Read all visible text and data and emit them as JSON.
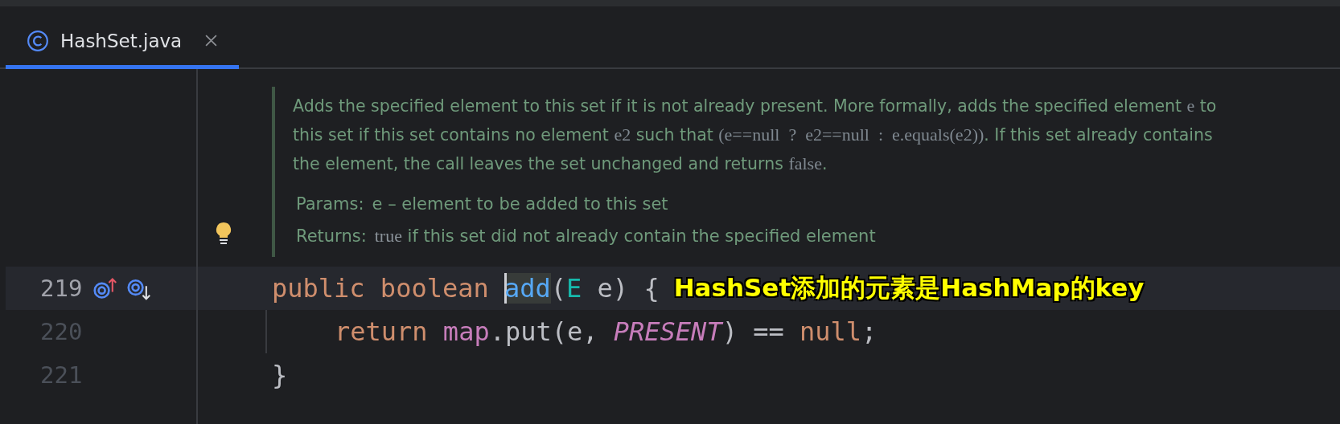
{
  "tabs": [
    {
      "label": "HashSet.java",
      "selected": true
    }
  ],
  "doc": {
    "paragraph": [
      {
        "kind": "text",
        "text": "Adds the specified element to this set if it is not already present. More formally, adds the specified element "
      },
      {
        "kind": "code",
        "text": "e"
      },
      {
        "kind": "text",
        "text": " to this set if this set contains no element "
      },
      {
        "kind": "code",
        "text": "e2"
      },
      {
        "kind": "text",
        "text": " such that "
      },
      {
        "kind": "code",
        "text": "(e==null  ?  e2==null  :  e.equals(e2))"
      },
      {
        "kind": "text",
        "text": ". If this set already contains the element, the call leaves the set unchanged and returns "
      },
      {
        "kind": "code",
        "text": "false"
      },
      {
        "kind": "text",
        "text": "."
      }
    ],
    "params": {
      "label": "Params:",
      "value": "e – element to be added to this set"
    },
    "returns": {
      "label": "Returns:",
      "value": [
        {
          "kind": "code",
          "text": "true"
        },
        {
          "kind": "text",
          "text": " if this set did not already contain the specified element"
        }
      ]
    }
  },
  "lines": [
    {
      "number": "219",
      "current": true,
      "tokens": [
        {
          "kind": "keyword",
          "text": "public "
        },
        {
          "kind": "keyword",
          "text": "boolean "
        },
        {
          "kind": "method",
          "text": "add",
          "caret": true
        },
        {
          "kind": "plain",
          "text": "("
        },
        {
          "kind": "type",
          "text": "E"
        },
        {
          "kind": "plain",
          "text": " e) {"
        }
      ],
      "children": [
        {
          "number": "220",
          "current": false,
          "tokens": [
            {
              "kind": "keyword",
              "text": "return "
            },
            {
              "kind": "field",
              "text": "map"
            },
            {
              "kind": "plain",
              "text": ".put(e, "
            },
            {
              "kind": "constant",
              "text": "PRESENT"
            },
            {
              "kind": "plain",
              "text": ") == "
            },
            {
              "kind": "keyword",
              "text": "null"
            },
            {
              "kind": "plain",
              "text": ";"
            }
          ]
        }
      ]
    },
    {
      "number": "221",
      "current": false,
      "tokens": [
        {
          "kind": "plain",
          "text": "}"
        }
      ]
    }
  ],
  "annotation": {
    "text": "HashSet添加的元素是HashMap的key"
  }
}
